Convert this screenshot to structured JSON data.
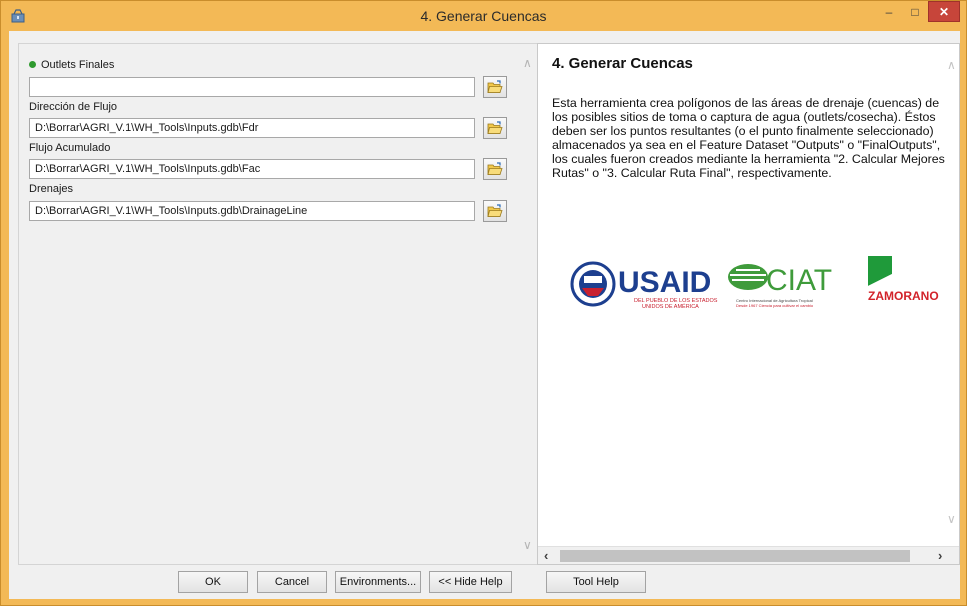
{
  "window": {
    "title": "4. Generar Cuencas",
    "minimize": "–",
    "maximize": "□",
    "close": "✕"
  },
  "params": [
    {
      "label": "Outlets Finales",
      "required": true,
      "value": ""
    },
    {
      "label": "Dirección de Flujo",
      "required": false,
      "value": "D:\\Borrar\\AGRI_V.1\\WH_Tools\\Inputs.gdb\\Fdr"
    },
    {
      "label": "Flujo Acumulado",
      "required": false,
      "value": "D:\\Borrar\\AGRI_V.1\\WH_Tools\\Inputs.gdb\\Fac"
    },
    {
      "label": "Drenajes",
      "required": false,
      "value": "D:\\Borrar\\AGRI_V.1\\WH_Tools\\Inputs.gdb\\DrainageLine"
    }
  ],
  "help": {
    "title": "4. Generar Cuencas",
    "body": "Esta herramienta crea polígonos de las áreas de drenaje (cuencas) de los posibles sitios de toma o captura de agua (outlets/cosecha). Éstos deben ser los puntos resultantes (o el punto finalmente seleccionado) almacenados ya sea en el Feature Dataset \"Outputs\" o \"FinalOutputs\", los cuales fueron creados mediante la herramienta \"2. Calcular Mejores Rutas\" o \"3. Calcular Ruta Final\", respectivamente.",
    "logos": {
      "usaid": "USAID",
      "usaid_sub1": "DEL PUEBLO DE LOS ESTADOS",
      "usaid_sub2": "UNIDOS DE AMÉRICA",
      "ciat": "CIAT",
      "ciat_sub1": "Centro Internacional de Agricultura Tropical",
      "ciat_sub2": "Desde 1967 Ciencia para cultivar el cambio",
      "zamorano": "ZAMORANO"
    }
  },
  "buttons": {
    "ok": "OK",
    "cancel": "Cancel",
    "environments": "Environments...",
    "hide_help": "<< Hide Help",
    "tool_help": "Tool Help"
  },
  "colors": {
    "titlebar": "#f3b956",
    "close": "#c7453a",
    "required_dot": "#2f9a2f",
    "usaid_blue": "#1d3f8f",
    "usaid_red": "#c8202f",
    "ciat_green": "#3f9b3b",
    "zamorano_green": "#1f9a3a",
    "zamorano_red": "#d2232a"
  }
}
